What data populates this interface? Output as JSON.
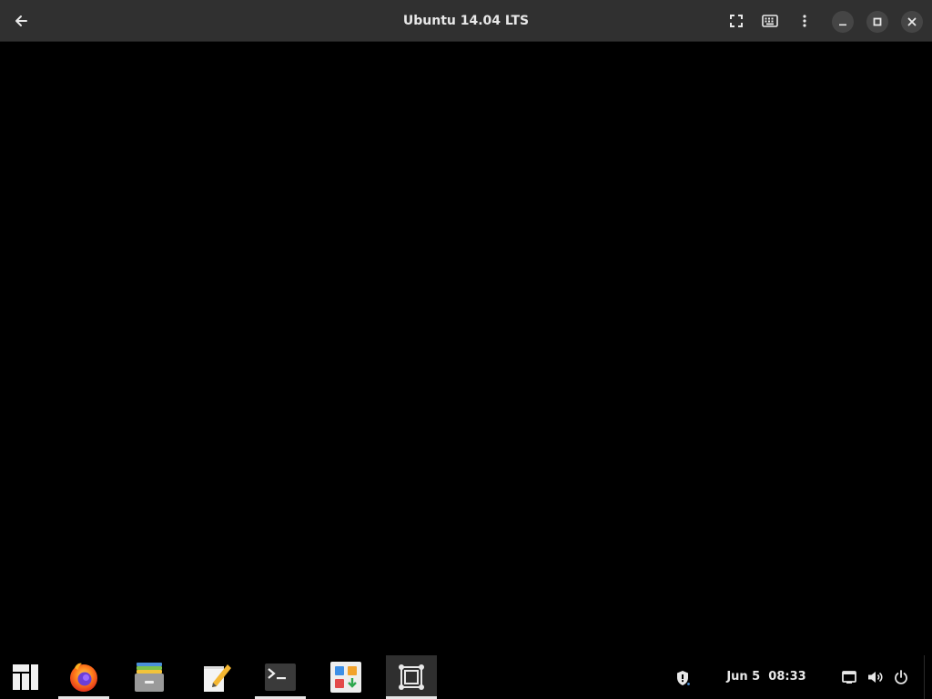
{
  "window": {
    "title": "Ubuntu 14.04 LTS"
  },
  "headerbar": {
    "buttons": [
      {
        "name": "back",
        "icon": "arrow-left-icon"
      },
      {
        "name": "fullscreen",
        "icon": "fullscreen-icon"
      },
      {
        "name": "keyboard",
        "icon": "keyboard-icon"
      },
      {
        "name": "menu",
        "icon": "vertical-dots-icon"
      },
      {
        "name": "minimize",
        "icon": "minimize-icon"
      },
      {
        "name": "maximize",
        "icon": "maximize-icon"
      },
      {
        "name": "close",
        "icon": "close-icon"
      }
    ]
  },
  "taskbar": {
    "apps": [
      {
        "name": "Application Menu",
        "icon": "manjaro-logo-icon",
        "active": false
      },
      {
        "name": "Firefox",
        "icon": "firefox-icon",
        "active": true
      },
      {
        "name": "Files",
        "icon": "file-cabinet-icon",
        "active": false
      },
      {
        "name": "Text Editor",
        "icon": "text-editor-icon",
        "active": false
      },
      {
        "name": "Terminal",
        "icon": "terminal-icon",
        "active": true
      },
      {
        "name": "Software",
        "icon": "software-store-icon",
        "active": false
      },
      {
        "name": "Virtual Machine",
        "icon": "vm-viewer-icon",
        "active": true
      }
    ],
    "clock": {
      "date": "Jun 5",
      "time": "08:33"
    },
    "tray": [
      "security-shield-icon",
      "network-icon",
      "volume-icon",
      "power-icon"
    ]
  },
  "colors": {
    "headerbar_bg": "#303030",
    "content_bg": "#000000",
    "taskbar_bg": "#000000",
    "text": "#e8e8e8",
    "active_indicator": "#e6e6e6"
  }
}
